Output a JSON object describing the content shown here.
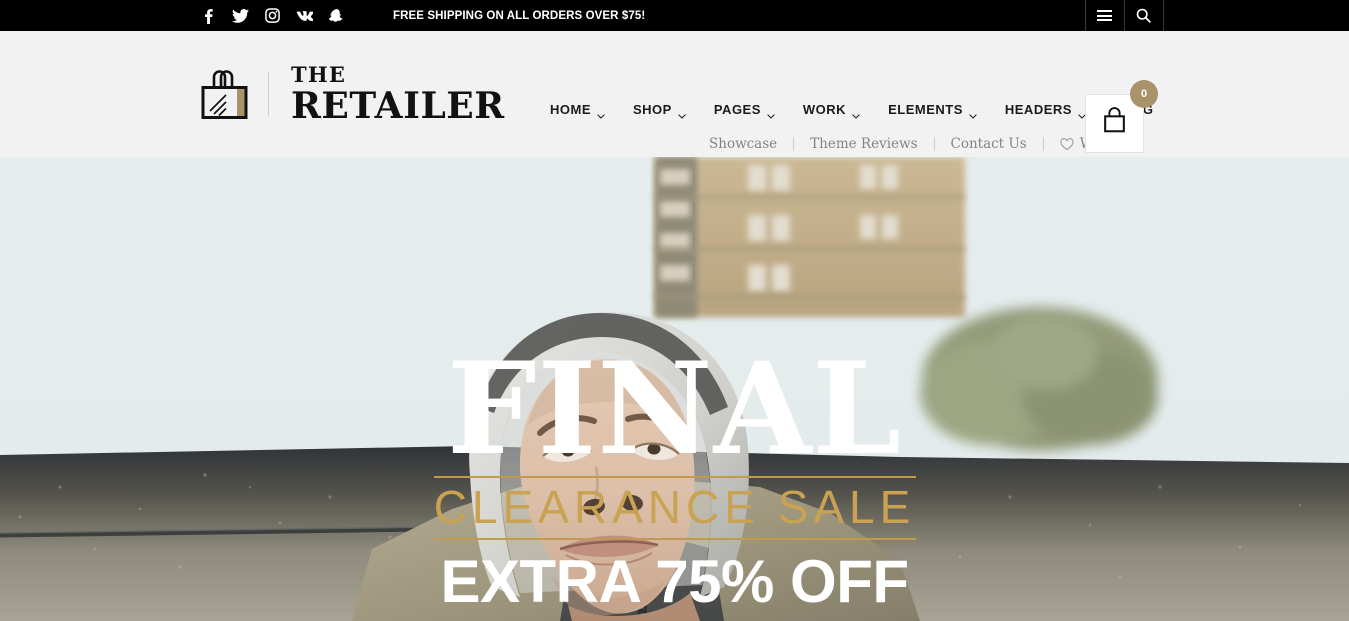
{
  "topbar": {
    "social": [
      {
        "name": "facebook-icon",
        "label": "Facebook"
      },
      {
        "name": "twitter-icon",
        "label": "Twitter"
      },
      {
        "name": "instagram-icon",
        "label": "Instagram"
      },
      {
        "name": "vk-icon",
        "label": "VK"
      },
      {
        "name": "snapchat-icon",
        "label": "Snapchat"
      }
    ],
    "message": "FREE SHIPPING ON ALL ORDERS OVER $75!",
    "menu_icon": "hamburger-menu-icon",
    "search_icon": "search-icon"
  },
  "logo": {
    "line1": "THE",
    "line2": "RETAILER",
    "icon": "shopping-bag-logo-icon",
    "accent_color": "#a8936a"
  },
  "mainnav": [
    {
      "label": "HOME",
      "has_dropdown": true
    },
    {
      "label": "SHOP",
      "has_dropdown": true
    },
    {
      "label": "PAGES",
      "has_dropdown": true
    },
    {
      "label": "WORK",
      "has_dropdown": true
    },
    {
      "label": "ELEMENTS",
      "has_dropdown": true
    },
    {
      "label": "HEADERS",
      "has_dropdown": true
    },
    {
      "label": "BLOG",
      "has_dropdown": false
    }
  ],
  "subnav": [
    {
      "label": "Showcase",
      "icon": null
    },
    {
      "label": "Theme Reviews",
      "icon": null
    },
    {
      "label": "Contact Us",
      "icon": null
    },
    {
      "label": "Wishlist",
      "icon": "heart-icon"
    }
  ],
  "cart": {
    "count": "0",
    "icon": "shopping-bag-icon"
  },
  "hero": {
    "headline": "FINAL",
    "subheadline": "CLEARANCE SALE",
    "offer": "EXTRA 75% OFF",
    "gold_color": "#c29a4e"
  }
}
